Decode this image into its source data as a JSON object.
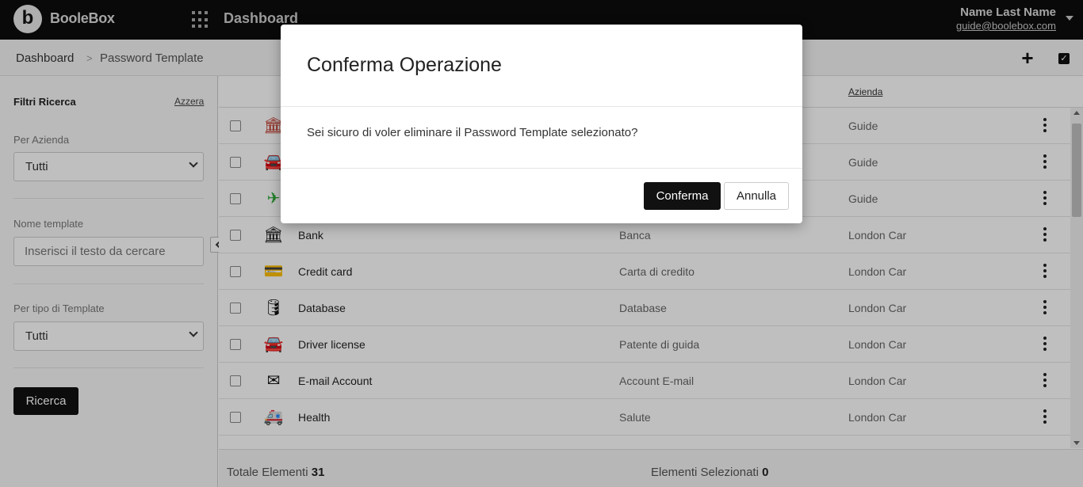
{
  "header": {
    "logo_letter": "b",
    "brand": "BooleBox",
    "title": "Dashboard",
    "user_name": "Name Last Name",
    "user_email": "guide@boolebox.com"
  },
  "breadcrumb": {
    "home": "Dashboard",
    "separator": ">",
    "current": "Password Template"
  },
  "sidebar": {
    "title": "Filtri Ricerca",
    "reset": "Azzera",
    "company_label": "Per Azienda",
    "company_value": "Tutti",
    "name_label": "Nome template",
    "name_placeholder": "Inserisci il testo da cercare",
    "type_label": "Per tipo di Template",
    "type_value": "Tutti",
    "search_button": "Ricerca"
  },
  "table": {
    "column_company": "Azienda",
    "rows": [
      {
        "name": "",
        "desc": "",
        "company": "Guide",
        "icon": "bank-icon",
        "glyph": "🏛",
        "color": "#c0392b"
      },
      {
        "name": "",
        "desc": "",
        "company": "Guide",
        "icon": "car-icon",
        "glyph": "🚘",
        "color": "#2a4fa8"
      },
      {
        "name": "",
        "desc": "",
        "company": "Guide",
        "icon": "airplane-icon",
        "glyph": "✈",
        "color": "#2eaa3a"
      },
      {
        "name": "Bank",
        "desc": "Banca",
        "company": "London Car",
        "icon": "bank-icon",
        "glyph": "🏛",
        "color": "#111111"
      },
      {
        "name": "Credit card",
        "desc": "Carta di credito",
        "company": "London Car",
        "icon": "credit-card-icon",
        "glyph": "💳",
        "color": "#111111"
      },
      {
        "name": "Database",
        "desc": "Database",
        "company": "London Car",
        "icon": "database-icon",
        "glyph": "🛢",
        "color": "#111111"
      },
      {
        "name": "Driver license",
        "desc": "Patente di guida",
        "company": "London Car",
        "icon": "car-icon",
        "glyph": "🚘",
        "color": "#111111"
      },
      {
        "name": "E-mail Account",
        "desc": "Account E-mail",
        "company": "London Car",
        "icon": "envelope-icon",
        "glyph": "✉",
        "color": "#111111"
      },
      {
        "name": "Health",
        "desc": "Salute",
        "company": "London Car",
        "icon": "ambulance-icon",
        "glyph": "🚑",
        "color": "#111111"
      }
    ]
  },
  "footer": {
    "total_label": "Totale Elementi",
    "total_value": "31",
    "selected_label": "Elementi Selezionati",
    "selected_value": "0"
  },
  "modal": {
    "title": "Conferma Operazione",
    "message": "Sei sicuro di voler eliminare il Password Template selezionato?",
    "confirm": "Conferma",
    "cancel": "Annulla"
  }
}
